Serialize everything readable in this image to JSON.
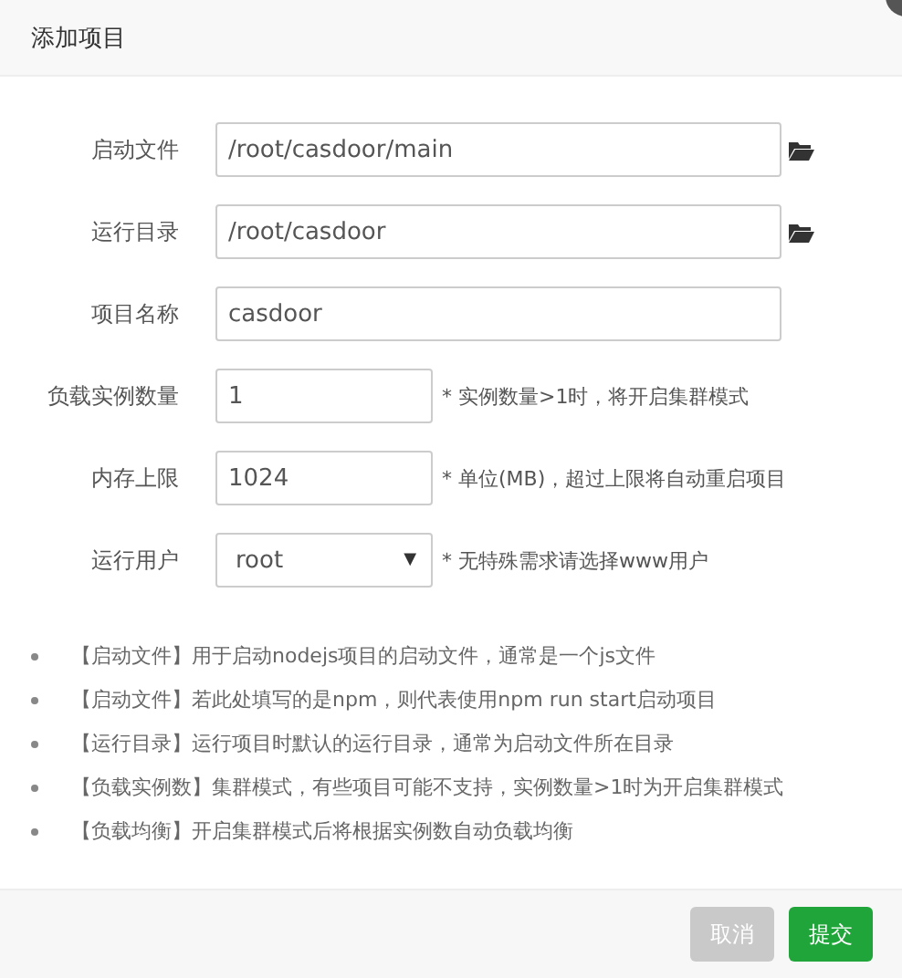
{
  "dialog": {
    "title": "添加项目"
  },
  "fields": [
    {
      "kind": "text",
      "label": "启动文件",
      "value": "/root/casdoor/main",
      "browse": true
    },
    {
      "kind": "text",
      "label": "运行目录",
      "value": "/root/casdoor",
      "browse": true
    },
    {
      "kind": "text",
      "label": "项目名称",
      "value": "casdoor",
      "browse": false
    },
    {
      "kind": "text",
      "label": "负载实例数量",
      "value": "1",
      "browse": false,
      "hint": "* 实例数量>1时，将开启集群模式"
    },
    {
      "kind": "text",
      "label": "内存上限",
      "value": "1024",
      "browse": false,
      "hint": "* 单位(MB)，超过上限将自动重启项目"
    },
    {
      "kind": "select",
      "label": "运行用户",
      "value": "root",
      "arrow": "▼",
      "browse": false,
      "hint": "* 无特殊需求请选择www用户"
    }
  ],
  "notes": [
    "【启动文件】用于启动nodejs项目的启动文件，通常是一个js文件",
    "【启动文件】若此处填写的是npm，则代表使用npm run start启动项目",
    "【运行目录】运行项目时默认的运行目录，通常为启动文件所在目录",
    "【负载实例数】集群模式，有些项目可能不支持，实例数量>1时为开启集群模式",
    "【负载均衡】开启集群模式后将根据实例数自动负载均衡"
  ],
  "buttons": [
    {
      "label": "取消",
      "kind": "cancel",
      "disabled": true
    },
    {
      "label": "提交",
      "kind": "submit",
      "disabled": false
    }
  ]
}
